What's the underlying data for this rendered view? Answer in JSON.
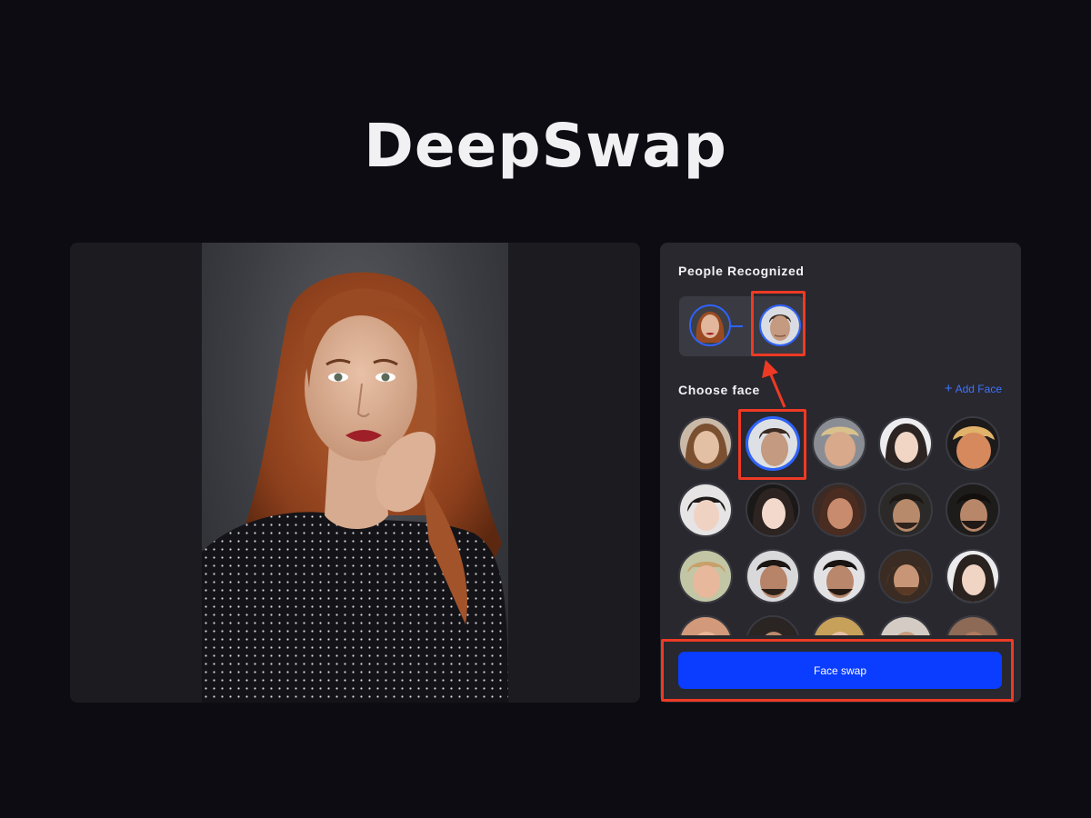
{
  "app": {
    "logo_text": "DeepSwap"
  },
  "panel": {
    "people_recognized_title": "People Recognized",
    "choose_face_title": "Choose face",
    "add_face_label": "Add Face",
    "face_swap_button": "Face swap"
  },
  "icons": {
    "plus": "plus-icon",
    "arrow": "arrow-up-icon"
  },
  "colors": {
    "accent_blue": "#0a3dff",
    "link_blue": "#3f72ff",
    "highlight_red": "#ee3a24",
    "background": "#0d0c12",
    "panel_bg": "#28282e"
  }
}
